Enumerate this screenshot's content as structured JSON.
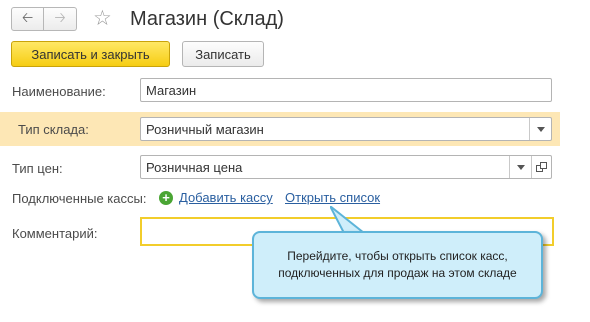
{
  "window": {
    "title": "Магазин (Склад)"
  },
  "toolbar": {
    "save_close_label": "Записать и закрыть",
    "save_label": "Записать"
  },
  "form": {
    "name_label": "Наименование:",
    "name_value": "Магазин",
    "warehouse_type_label": "Тип склада:",
    "warehouse_type_value": "Розничный магазин",
    "price_type_label": "Тип цен:",
    "price_type_value": "Розничная цена",
    "registers_label": "Подключенные кассы:",
    "add_register_link": "Добавить кассу",
    "open_list_link": "Открыть список",
    "comment_label": "Комментарий:",
    "comment_value": ""
  },
  "callout": {
    "line1": "Перейдите, чтобы открыть список касс,",
    "line2": "подключенных для продаж на этом складе"
  },
  "colors": {
    "primary_button": "#f6cd13",
    "highlight_row": "#fde7b5",
    "link": "#2a5fa0",
    "callout_bg": "#cfeefa",
    "callout_border": "#5db4d9",
    "add_icon": "#4aa533"
  },
  "icons": [
    "back-arrow-icon",
    "forward-arrow-icon",
    "star-icon",
    "dropdown-arrow-icon",
    "open-icon",
    "plus-icon"
  ]
}
